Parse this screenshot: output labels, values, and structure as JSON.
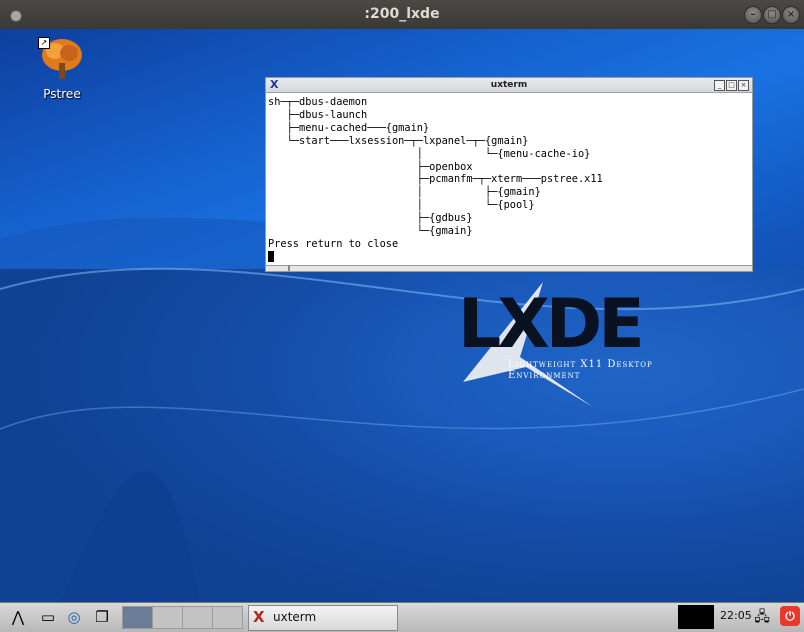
{
  "host_window": {
    "title": ":200_lxde"
  },
  "desktop": {
    "icons": [
      {
        "label": "Pstree",
        "icon": "tree-icon"
      }
    ],
    "logo": {
      "word": "LXDE",
      "subtitle": "Lightweight X11 Desktop Environment"
    }
  },
  "uxterm": {
    "title": "uxterm",
    "lines": [
      "sh─┬─dbus-daemon",
      "   ├─dbus-launch",
      "   ├─menu-cached───{gmain}",
      "   └─start───lxsession─┬─lxpanel─┬─{gmain}",
      "                        │          └─{menu-cache-io}",
      "                        ├─openbox",
      "                        ├─pcmanfm─┬─xterm───pstree.x11",
      "                        │          ├─{gmain}",
      "                        │          └─{pool}",
      "                        ├─{gdbus}",
      "                        └─{gmain}",
      "Press return to close"
    ]
  },
  "taskbar": {
    "task_label": "uxterm",
    "clock": "22:05",
    "colors": {
      "power": "#e8382b"
    }
  }
}
